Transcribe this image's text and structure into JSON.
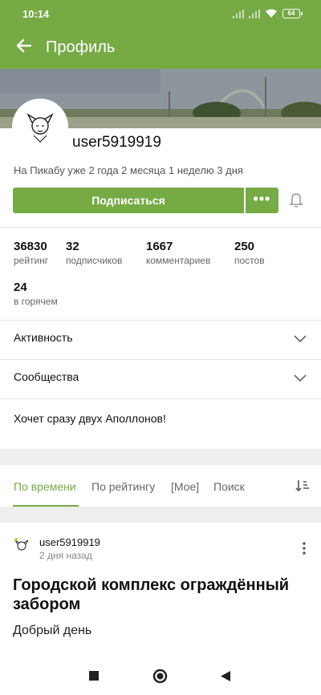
{
  "status": {
    "time": "10:14",
    "battery": "64"
  },
  "appbar": {
    "title": "Профиль"
  },
  "profile": {
    "username": "user5919919",
    "since": "На Пикабу уже 2 года 2 месяца 1 неделю 3 дня",
    "subscribe_label": "Подписаться",
    "more_label": "•••"
  },
  "stats": [
    {
      "value": "36830",
      "label": "рейтинг"
    },
    {
      "value": "32",
      "label": "подписчиков"
    },
    {
      "value": "1667",
      "label": "комментариев"
    },
    {
      "value": "250",
      "label": "постов"
    },
    {
      "value": "24",
      "label": "в горячем"
    }
  ],
  "sections": [
    {
      "label": "Активность"
    },
    {
      "label": "Сообщества"
    }
  ],
  "bio": "Хочет сразу двух Аполлонов!",
  "tabs": [
    {
      "label": "По времени",
      "active": true
    },
    {
      "label": "По рейтингу",
      "active": false
    },
    {
      "label": "[Мое]",
      "active": false
    },
    {
      "label": "Поиск",
      "active": false
    }
  ],
  "post": {
    "author": "user5919919",
    "ago": "2 дня назад",
    "title": "Городской комплекс ограждённый забором",
    "body": "Добрый день"
  },
  "colors": {
    "accent": "#76aa45"
  },
  "icons": [
    "back-arrow-icon",
    "bell-icon",
    "chevron-down-icon",
    "sort-icon",
    "kebab-menu-icon",
    "nav-square-icon",
    "nav-circle-icon",
    "nav-back-triangle-icon"
  ]
}
